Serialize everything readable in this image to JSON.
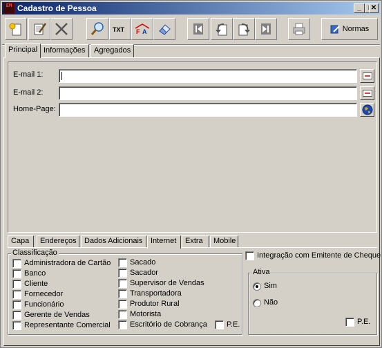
{
  "window": {
    "title": "Cadastro de Pessoa",
    "icon_text": "EM",
    "minimize": "_",
    "maximize": "□",
    "close": "✕"
  },
  "toolbar": {
    "buttons": [
      {
        "name": "new",
        "glyph": "✚"
      },
      {
        "name": "edit",
        "glyph": "✎"
      },
      {
        "name": "delete",
        "glyph": "✕"
      },
      {
        "name": "search",
        "glyph": "⚲"
      },
      {
        "name": "txt",
        "glyph": "TXT"
      },
      {
        "name": "fa",
        "glyph": "FA"
      },
      {
        "name": "eraser",
        "glyph": "◆"
      },
      {
        "name": "first",
        "glyph": "|◀"
      },
      {
        "name": "prev",
        "glyph": "↩"
      },
      {
        "name": "next",
        "glyph": "↪"
      },
      {
        "name": "last",
        "glyph": "▶|"
      },
      {
        "name": "print",
        "glyph": "⎙"
      }
    ],
    "normas_label": "Normas"
  },
  "top_tabs": [
    "Principal",
    "Informações",
    "Agregados"
  ],
  "fields": {
    "email1": {
      "label": "E-mail 1:",
      "value": ""
    },
    "email2": {
      "label": "E-mail 2:",
      "value": ""
    },
    "homepage": {
      "label": "Home-Page:",
      "value": ""
    }
  },
  "bottom_tabs": [
    "Capa",
    "Endereços",
    "Dados Adicionais",
    "Internet",
    "Extra",
    "Mobile"
  ],
  "classificacao": {
    "title": "Classificação",
    "col1": [
      "Administradora de Cartão",
      "Banco",
      "Cliente",
      "Fornecedor",
      "Funcionário",
      "Gerente de Vendas",
      "Representante Comercial"
    ],
    "col2": [
      "Sacado",
      "Sacador",
      "Supervisor de Vendas",
      "Transportadora",
      "Produtor Rural",
      "Motorista",
      "Escritório de Cobrança"
    ],
    "pe_label": "P.E."
  },
  "integracao_label": "Integração com Emitente de Cheque",
  "ativa": {
    "title": "Ativa",
    "options": [
      "Sim",
      "Não"
    ],
    "selected": "Sim",
    "pe_label": "P.E."
  }
}
